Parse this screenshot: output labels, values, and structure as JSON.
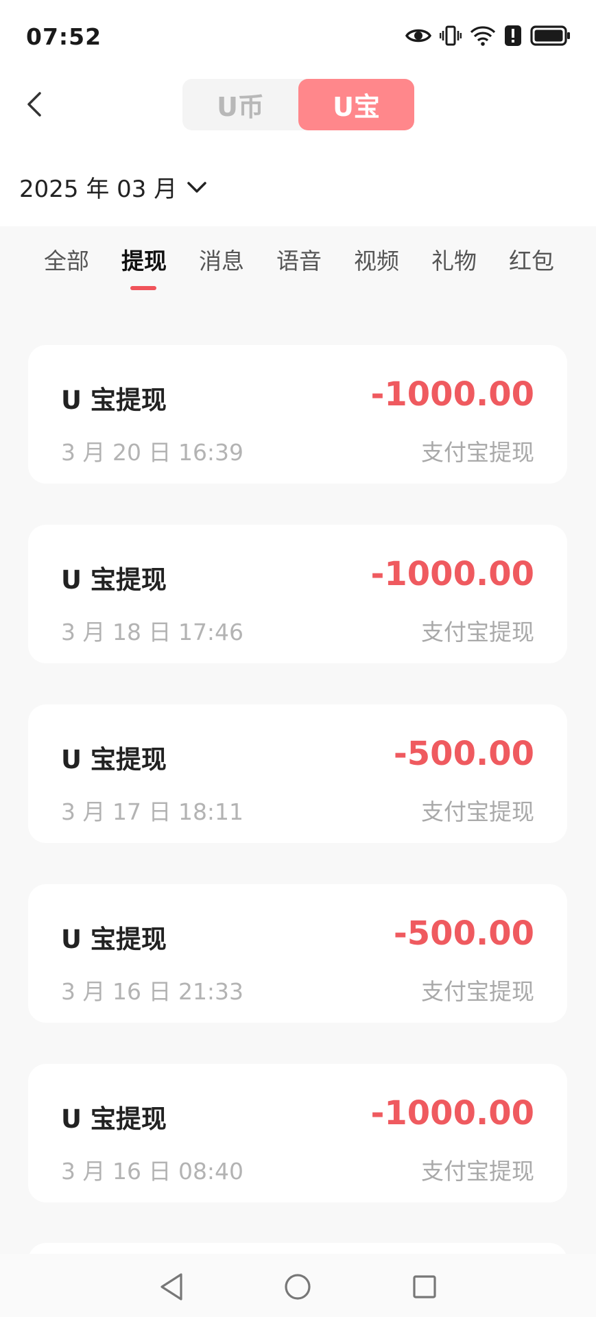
{
  "status_bar": {
    "time": "07:52",
    "icons": [
      "eye-icon",
      "vibrate-icon",
      "wifi-icon",
      "alert-icon",
      "battery-icon"
    ]
  },
  "header": {
    "back_icon": "chevron-left-icon",
    "segments": [
      {
        "label": "U币",
        "active": false
      },
      {
        "label": "U宝",
        "active": true
      }
    ],
    "accent_color": "#ff878b"
  },
  "filter": {
    "month": "2025 年 03 月",
    "icon": "chevron-down-icon"
  },
  "tabs": [
    {
      "label": "全部",
      "active": false
    },
    {
      "label": "提现",
      "active": true
    },
    {
      "label": "消息",
      "active": false
    },
    {
      "label": "语音",
      "active": false
    },
    {
      "label": "视频",
      "active": false
    },
    {
      "label": "礼物",
      "active": false
    },
    {
      "label": "红包",
      "active": false
    }
  ],
  "transactions": [
    {
      "title": "U 宝提现",
      "amount": "-1000.00",
      "date": "3 月 20 日 16:39",
      "method": "支付宝提现"
    },
    {
      "title": "U 宝提现",
      "amount": "-1000.00",
      "date": "3 月 18 日 17:46",
      "method": "支付宝提现"
    },
    {
      "title": "U 宝提现",
      "amount": "-500.00",
      "date": "3 月 17 日 18:11",
      "method": "支付宝提现"
    },
    {
      "title": "U 宝提现",
      "amount": "-500.00",
      "date": "3 月 16 日 21:33",
      "method": "支付宝提现"
    },
    {
      "title": "U 宝提现",
      "amount": "-1000.00",
      "date": "3 月 16 日 08:40",
      "method": "支付宝提现"
    }
  ],
  "amount_color": "#ef5a5f",
  "nav_bar": {
    "icons": [
      "back-triangle-icon",
      "home-circle-icon",
      "recents-square-icon"
    ]
  }
}
